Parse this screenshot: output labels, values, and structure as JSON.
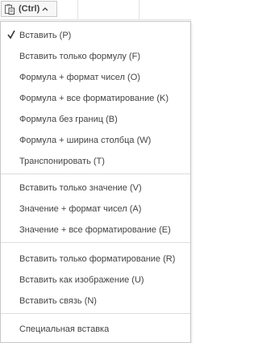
{
  "trigger": {
    "label": "(Ctrl)"
  },
  "menu": {
    "group1": [
      {
        "label": "Вставить (P)",
        "checked": true
      },
      {
        "label": "Вставить только формулу (F)"
      },
      {
        "label": "Формула + формат чисел (O)"
      },
      {
        "label": "Формула + все форматирование (K)"
      },
      {
        "label": "Формула без границ (B)"
      },
      {
        "label": "Формула + ширина столбца (W)"
      },
      {
        "label": "Транспонировать (T)"
      }
    ],
    "group2": [
      {
        "label": "Вставить только значение (V)"
      },
      {
        "label": "Значение + формат чисел (A)"
      },
      {
        "label": "Значение + все форматирование (E)"
      }
    ],
    "group3": [
      {
        "label": "Вставить только форматирование (R)"
      },
      {
        "label": "Вставить как изображение (U)"
      },
      {
        "label": "Вставить связь (N)"
      }
    ],
    "group4": [
      {
        "label": "Специальная вставка"
      }
    ]
  },
  "colors": {
    "text": "#444444",
    "border": "#c8c8c8",
    "separator": "#dddddd"
  }
}
